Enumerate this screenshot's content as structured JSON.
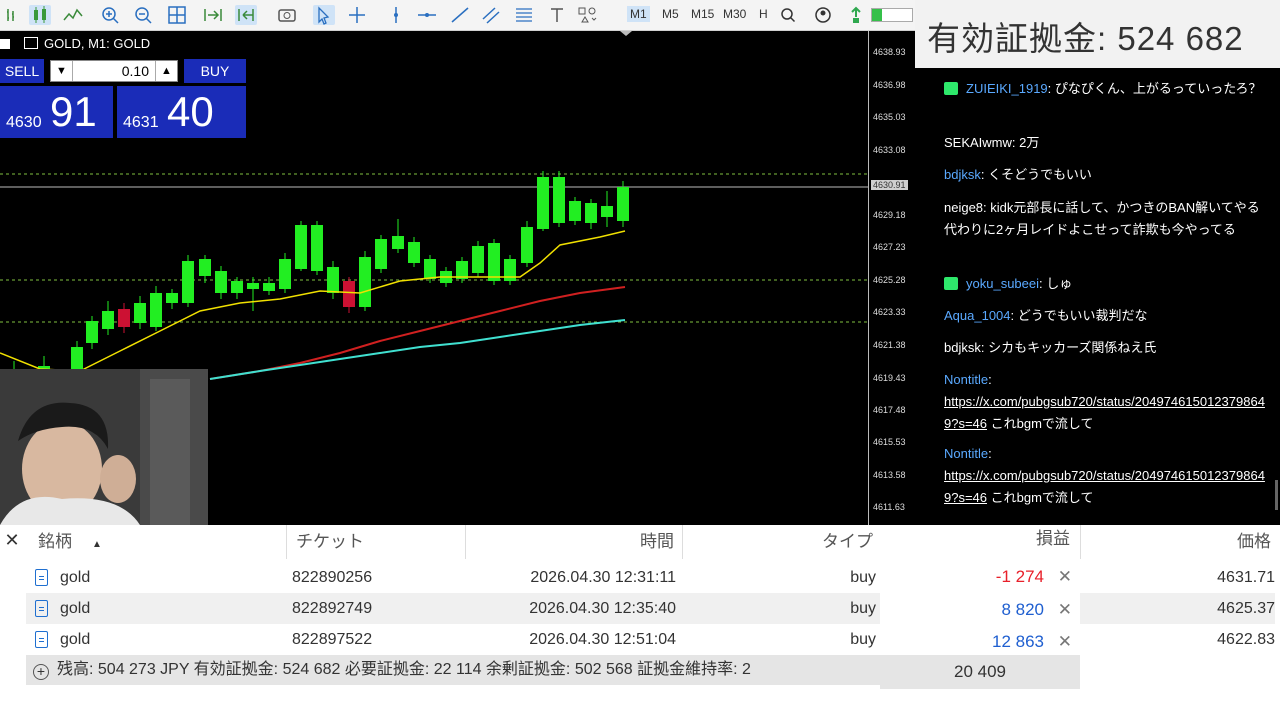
{
  "toolbar": {
    "timeframes": [
      "M1",
      "M5",
      "M15",
      "M30",
      "H"
    ],
    "selected_timeframe": "M1"
  },
  "chart": {
    "title": "GOLD, M1:  GOLD",
    "price_ticks": [
      "4638.93",
      "4636.98",
      "4635.03",
      "4633.08",
      "4630.91",
      "4629.18",
      "4627.23",
      "4625.28",
      "4623.33",
      "4621.38",
      "4619.43",
      "4617.48",
      "4615.53",
      "4613.58",
      "4611.63"
    ],
    "current_price_tick": "4630.91",
    "colors": {
      "bull_candle": "#22ee22",
      "bear_candle": "#cc1133",
      "ma_fast": "#f0e000",
      "ma_mid": "#d02020",
      "ma_slow": "#40e0d0",
      "level_line": "#7fbf3f"
    }
  },
  "one_click": {
    "sell_label": "SELL",
    "buy_label": "BUY",
    "lot": "0.10",
    "sell_price_prefix": "4630",
    "sell_price_big": "91",
    "buy_price_prefix": "4631",
    "buy_price_big": "40"
  },
  "balance_header": {
    "text": "有効証拠金: 524 682"
  },
  "chat": {
    "messages": [
      {
        "user": "ZUIEIKI_1919",
        "text": ": ぴなぴくん、上がるっていったろ？",
        "badge": true,
        "user_color": "blue"
      },
      {
        "user": "SEKAIwmw",
        "text": ": 2万",
        "badge": false,
        "user_color": "white"
      },
      {
        "user": "bdjksk",
        "text": ": くそどうでもいい",
        "badge": false,
        "user_color": "blue"
      },
      {
        "user": "neige8",
        "text": ": kidk元部長に話して、かつきのBAN解いてやる代わりに2ヶ月レイドよこせって詐欺も今やってる",
        "badge": false,
        "user_color": "white"
      },
      {
        "user": "yoku_subeei",
        "text": ": しゅ",
        "badge": true,
        "user_color": "blue"
      },
      {
        "user": "Aqua_1004",
        "text": ": どうでもいい裁判だな",
        "badge": false,
        "user_color": "blue"
      },
      {
        "user": "bdjksk",
        "text": ": シカもキッカーズ関係ねえ氏",
        "badge": false,
        "user_color": "blue"
      },
      {
        "user": "Nontitle",
        "text": ":",
        "link": "https://x.com/pubgsub720/status/2049746150123798649?s=46",
        "after": " これbgmで流して",
        "badge": false,
        "user_color": "blue"
      },
      {
        "user": "Nontitle",
        "text": ":",
        "link": "https://x.com/pubgsub720/status/2049746150123798649?s=46",
        "after": " これbgmで流して",
        "badge": false,
        "user_color": "blue"
      }
    ]
  },
  "terminal": {
    "columns": {
      "symbol": "銘柄",
      "ticket": "チケット",
      "time": "時間",
      "type": "タイプ",
      "profit": "損益",
      "price": "価格"
    },
    "rows": [
      {
        "symbol": "gold",
        "ticket": "822890256",
        "time": "2026.04.30 12:31:11",
        "type": "buy",
        "profit": "-1 274",
        "price": "4631.71"
      },
      {
        "symbol": "gold",
        "ticket": "822892749",
        "time": "2026.04.30 12:35:40",
        "type": "buy",
        "profit": "8 820",
        "price": "4625.37"
      },
      {
        "symbol": "gold",
        "ticket": "822897522",
        "time": "2026.04.30 12:51:04",
        "type": "buy",
        "profit": "12 863",
        "price": "4622.83"
      }
    ],
    "summary": "残高: 504 273 JPY  有効証拠金: 524 682  必要証拠金: 22 114  余剰証拠金: 502 568  証拠金維持率: 2",
    "total_profit": "20 409",
    "colors": {
      "loss": "#e8202a",
      "profit": "#1f5fd0"
    }
  }
}
